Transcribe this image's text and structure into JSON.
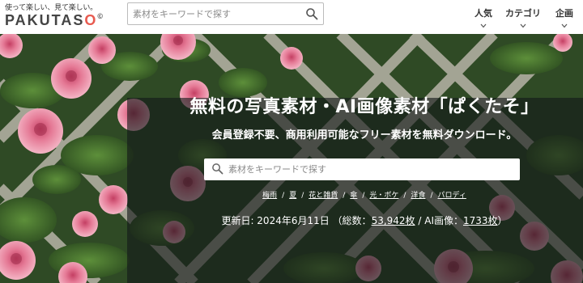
{
  "header": {
    "tagline": "使って楽しい、見て楽しい。",
    "logo": "PAKUTASO",
    "search_placeholder": "素材をキーワードで探す",
    "nav": [
      {
        "label": "人気"
      },
      {
        "label": "カテゴリ"
      },
      {
        "label": "企画"
      }
    ]
  },
  "hero": {
    "title": "無料の写真素材・AI画像素材「ぱくたそ」",
    "subtitle": "会員登録不要、商用利用可能なフリー素材を無料ダウンロード。",
    "search_placeholder": "素材をキーワードで探す",
    "tags": [
      "梅雨",
      "夏",
      "花と雑貨",
      "傘",
      "光・ボケ",
      "洋食",
      "パロディ"
    ],
    "tag_separator": "/",
    "updated": {
      "prefix": "更新日: 2024年6月11日 （総数：",
      "total": "53,942枚",
      "middle": " / AI画像：",
      "ai_total": "1733枚",
      "suffix": "）"
    }
  },
  "colors": {
    "logo_accent": "#e85a4f",
    "overlay": "rgba(20,24,24,0.62)",
    "foliage": "#2f4a25",
    "rose": "#e57a96"
  }
}
